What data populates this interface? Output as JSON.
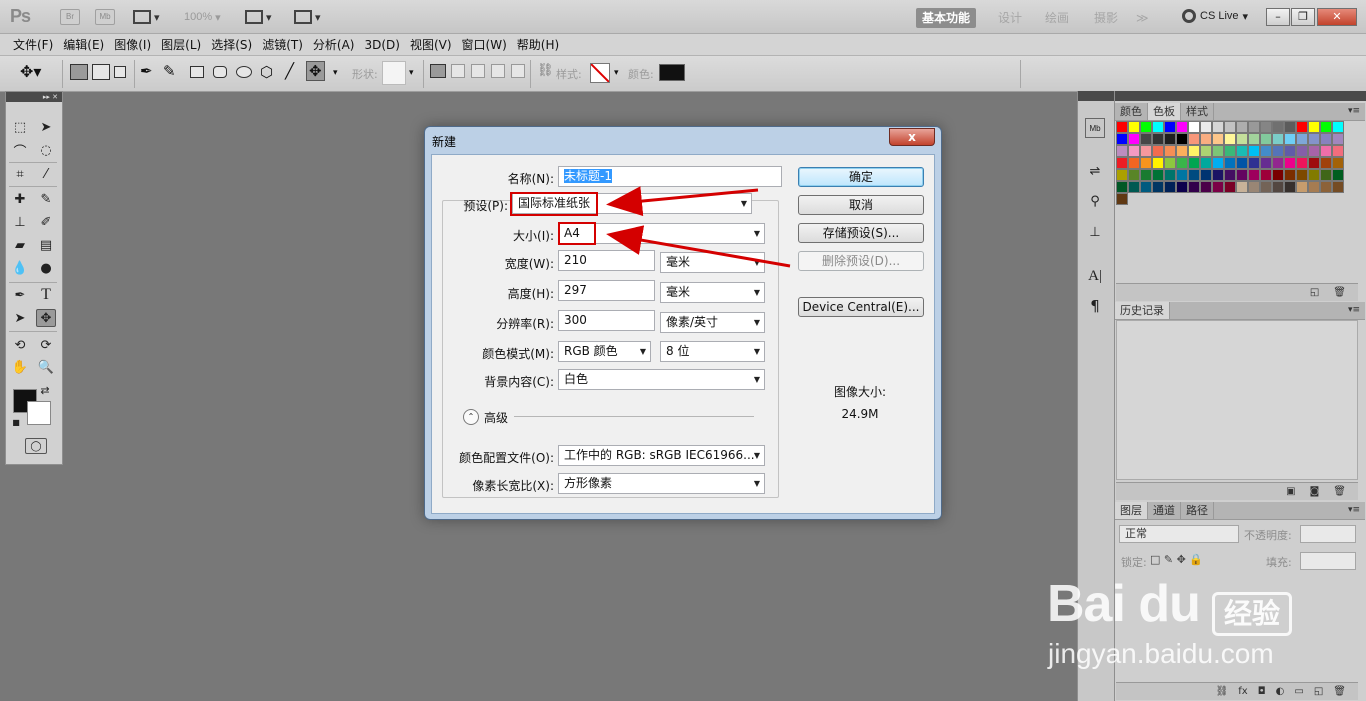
{
  "app": {
    "logo": "Ps",
    "bridge": "Br",
    "mini_bridge": "Mb",
    "zoom": "100%",
    "workspaces": [
      "基本功能",
      "设计",
      "绘画",
      "摄影",
      "≫"
    ],
    "cs_live": "CS Live"
  },
  "menu": [
    "文件(F)",
    "编辑(E)",
    "图像(I)",
    "图层(L)",
    "选择(S)",
    "滤镜(T)",
    "分析(A)",
    "3D(D)",
    "视图(V)",
    "窗口(W)",
    "帮助(H)"
  ],
  "options": {
    "shape_label": "形状:",
    "style_label": "样式:",
    "color_label": "颜色:"
  },
  "dialog": {
    "title": "新建",
    "close": "x",
    "name_label": "名称(N):",
    "name_value": "未标题-1",
    "preset_label": "预设(P):",
    "preset_value": "国际标准纸张",
    "size_label": "大小(I):",
    "size_value": "A4",
    "width_label": "宽度(W):",
    "width_value": "210",
    "width_unit": "毫米",
    "height_label": "高度(H):",
    "height_value": "297",
    "height_unit": "毫米",
    "resolution_label": "分辨率(R):",
    "resolution_value": "300",
    "resolution_unit": "像素/英寸",
    "color_mode_label": "颜色模式(M):",
    "color_mode_value": "RGB 颜色",
    "bit_depth": "8 位",
    "bg_label": "背景内容(C):",
    "bg_value": "白色",
    "advanced_label": "高级",
    "color_profile_label": "颜色配置文件(O):",
    "color_profile_value": "工作中的 RGB: sRGB IEC61966...",
    "pixel_aspect_label": "像素长宽比(X):",
    "pixel_aspect_value": "方形像素",
    "ok": "确定",
    "cancel": "取消",
    "save_preset": "存储预设(S)...",
    "delete_preset": "删除预设(D)...",
    "device_central": "Device Central(E)...",
    "image_size_label": "图像大小:",
    "image_size_value": "24.9M"
  },
  "panels": {
    "color_tabs": [
      "颜色",
      "色板",
      "样式"
    ],
    "history_tab": "历史记录",
    "layer_tabs": [
      "图层",
      "通道",
      "路径"
    ],
    "blend_mode": "正常",
    "opacity_label": "不透明度:",
    "lock_label": "锁定:",
    "fill_label": "填充:"
  },
  "watermark": {
    "logo": "Bai  du",
    "jingyan": "经验",
    "url": "jingyan.baidu.com"
  },
  "swatches": [
    "#ff0000",
    "#ffff00",
    "#00ff00",
    "#00ffff",
    "#0000ff",
    "#ff00ff",
    "#ffffff",
    "#ebebeb",
    "#d6d6d6",
    "#c2c2c2",
    "#adadad",
    "#999999",
    "#858585",
    "#707070",
    "#5c5c5c",
    "#ff0000",
    "#ffff00",
    "#00ff00",
    "#00ffff",
    "#0000ff",
    "#ff00ff",
    "#474747",
    "#333333",
    "#1f1f1f",
    "#000000",
    "#f7977a",
    "#f9ad81",
    "#fdc68a",
    "#fff79a",
    "#c4df9b",
    "#a2d39c",
    "#82ca9d",
    "#7bcdc8",
    "#6ecff6",
    "#7ea7d8",
    "#8493ca",
    "#8882be",
    "#a187be",
    "#bc8dbf",
    "#f49ac2",
    "#f6989d",
    "#f26c4f",
    "#f68e55",
    "#fbaf5c",
    "#fff467",
    "#acd372",
    "#7cc576",
    "#3bb878",
    "#1abbb4",
    "#00bff3",
    "#438cca",
    "#5574b9",
    "#605ca8",
    "#855fa8",
    "#a763a8",
    "#f06ea9",
    "#f26d7d",
    "#ed1c24",
    "#f26522",
    "#f7941d",
    "#fff200",
    "#8dc73f",
    "#39b54a",
    "#00a651",
    "#00a99d",
    "#00aeef",
    "#0072bc",
    "#0054a6",
    "#2e3192",
    "#662d91",
    "#92278f",
    "#ec008c",
    "#ed145b",
    "#9e0b0f",
    "#a0410d",
    "#a36209",
    "#aba000",
    "#598527",
    "#197b30",
    "#007236",
    "#00746b",
    "#0076a3",
    "#004b80",
    "#003471",
    "#1b1464",
    "#440e62",
    "#630460",
    "#9e005d",
    "#9e0039",
    "#790000",
    "#7b2e00",
    "#7d4900",
    "#827b00",
    "#406618",
    "#005e20",
    "#005826",
    "#005952",
    "#005b7f",
    "#003663",
    "#002157",
    "#0d004c",
    "#32004b",
    "#4b0049",
    "#7b0046",
    "#7a0026",
    "#c7b299",
    "#998675",
    "#736357",
    "#534741",
    "#37302d",
    "#c69c6d",
    "#a67c52",
    "#8c6239",
    "#754c24",
    "#603913"
  ]
}
